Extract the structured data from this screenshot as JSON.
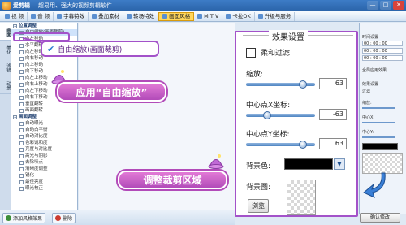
{
  "window": {
    "app_name": "爱剪辑",
    "tagline": "超易用、强大的视频剪辑软件",
    "controls": [
      "—",
      "□",
      "✕"
    ]
  },
  "menubar": {
    "items": [
      {
        "label": "视 频",
        "active": false
      },
      {
        "label": "音 频",
        "active": false
      },
      {
        "label": "字幕特效",
        "active": false
      },
      {
        "label": "叠加素材",
        "active": false
      },
      {
        "label": "转场特效",
        "active": false
      },
      {
        "label": "画面风格",
        "active": true
      },
      {
        "label": "M T V",
        "active": false
      },
      {
        "label": "卡拉OK",
        "active": false
      },
      {
        "label": "升级与服务",
        "active": false
      }
    ]
  },
  "vtabs": [
    "画面",
    "美化",
    "滤镜",
    "动景"
  ],
  "tree": {
    "group1": "位置调整",
    "group1_items": [
      "自由缩放(画面裁剪)",
      "向左移动",
      "水平翻转",
      "向左移动",
      "向右移动",
      "向上移动",
      "向下移动",
      "向左上移动",
      "向右上移动",
      "向左下移动",
      "向右下移动",
      "垂直翻转",
      "画面翻转"
    ],
    "group2": "画面调整",
    "group2_items": [
      "自动曝光",
      "自动白平衡",
      "自动对比度",
      "色彩饱和度",
      "亮度与对比度",
      "高光与阴影",
      "去除噪点",
      "清晰度调整",
      "锐化",
      "最佳亮度",
      "曝光校正"
    ]
  },
  "callout": {
    "check": "✔",
    "label": "自由缩放(画面裁剪)"
  },
  "banners": {
    "apply": "应用“自由缩放”",
    "adjust": "调整裁剪区域"
  },
  "panel": {
    "title": "效果设置",
    "soft_filter_label": "柔和过滤",
    "zoom_label": "缩放:",
    "zoom_value": "63",
    "zoom_level": 0.82,
    "cx_label": "中心点X坐标:",
    "cx_value": "-63",
    "cx_level": 0.3,
    "cy_label": "中心点Y坐标:",
    "cy_value": "63",
    "cy_level": 0.82,
    "bgcolor_label": "背景色:",
    "bgcolor_value": "#000000",
    "bgimg_label": "背景图:",
    "browse_label": "浏览"
  },
  "right_panel": {
    "time_title": "时间设置",
    "start_time": "00 : 00 : 00",
    "end_time": "00 : 00 : 00",
    "duration": "00 : 00 : 00",
    "full_effect": "全局应用效果",
    "effect_title": "效果设置",
    "soft": "过滤",
    "zoom": "缩放:",
    "cx": "中心X:",
    "cy": "中心Y:",
    "ok": "确认修改"
  },
  "bottom": {
    "add_label": "添加风格效果",
    "delete_label": "删除"
  },
  "colors": {
    "accent_purple": "#a352c9",
    "title_blue": "#2a63a9",
    "active_tab": "#ffd65c"
  }
}
